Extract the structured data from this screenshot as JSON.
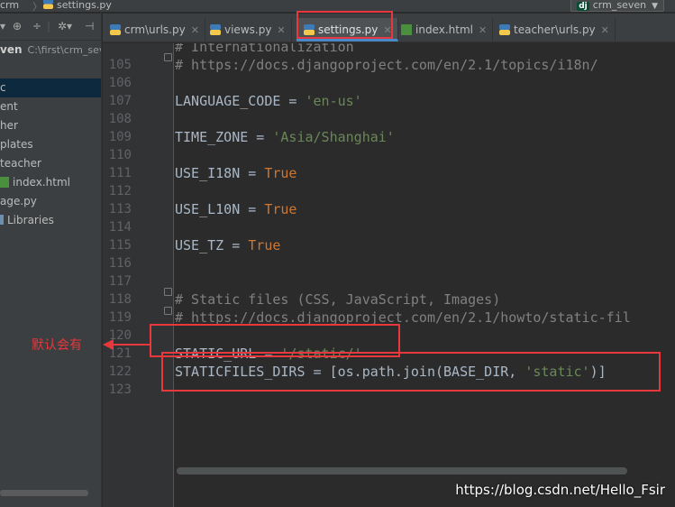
{
  "breadcrumb": {
    "project": "crm",
    "file": "settings.py"
  },
  "project_selector": {
    "badge": "dj",
    "label": "crm_seven"
  },
  "project_tree": {
    "root_name": "ven",
    "root_path": "C:\\first\\crm_seve",
    "items": [
      "c",
      "ent",
      "her",
      "plates",
      "teacher",
      "index.html",
      "age.py",
      "Libraries"
    ]
  },
  "tabs": [
    {
      "label": "crm\\urls.py"
    },
    {
      "label": "views.py"
    },
    {
      "label": "settings.py"
    },
    {
      "label": "index.html"
    },
    {
      "label": "teacher\\urls.py"
    }
  ],
  "editor": {
    "lines": [
      {
        "num": "",
        "tokens": [
          {
            "t": "# Internationalization",
            "c": "cmt"
          }
        ]
      },
      {
        "num": "105",
        "tokens": [
          {
            "t": "# https://docs.djangoproject.com/en/2.1/topics/i18n/",
            "c": "cmt"
          }
        ]
      },
      {
        "num": "106",
        "tokens": []
      },
      {
        "num": "107",
        "tokens": [
          {
            "t": "LANGUAGE_CODE",
            "c": "txt"
          },
          {
            "t": " = ",
            "c": "txt"
          },
          {
            "t": "'en-us'",
            "c": "str"
          }
        ]
      },
      {
        "num": "108",
        "tokens": []
      },
      {
        "num": "109",
        "tokens": [
          {
            "t": "TIME_ZONE",
            "c": "txt"
          },
          {
            "t": " = ",
            "c": "txt"
          },
          {
            "t": "'Asia/Shanghai'",
            "c": "str"
          }
        ]
      },
      {
        "num": "110",
        "tokens": []
      },
      {
        "num": "111",
        "tokens": [
          {
            "t": "USE_I18N",
            "c": "txt"
          },
          {
            "t": " = ",
            "c": "txt"
          },
          {
            "t": "True",
            "c": "kw"
          }
        ]
      },
      {
        "num": "112",
        "tokens": []
      },
      {
        "num": "113",
        "tokens": [
          {
            "t": "USE_L10N",
            "c": "txt"
          },
          {
            "t": " = ",
            "c": "txt"
          },
          {
            "t": "True",
            "c": "kw"
          }
        ]
      },
      {
        "num": "114",
        "tokens": []
      },
      {
        "num": "115",
        "tokens": [
          {
            "t": "USE_TZ",
            "c": "txt"
          },
          {
            "t": " = ",
            "c": "txt"
          },
          {
            "t": "True",
            "c": "kw"
          }
        ]
      },
      {
        "num": "116",
        "tokens": []
      },
      {
        "num": "117",
        "tokens": []
      },
      {
        "num": "118",
        "tokens": [
          {
            "t": "# Static files (CSS, JavaScript, Images)",
            "c": "cmt"
          }
        ]
      },
      {
        "num": "119",
        "tokens": [
          {
            "t": "# https://docs.djangoproject.com/en/2.1/howto/static-fil",
            "c": "cmt"
          }
        ]
      },
      {
        "num": "120",
        "tokens": []
      },
      {
        "num": "121",
        "tokens": [
          {
            "t": "STATIC_URL",
            "c": "txt"
          },
          {
            "t": " = ",
            "c": "txt"
          },
          {
            "t": "'/static/'",
            "c": "str"
          }
        ]
      },
      {
        "num": "122",
        "tokens": [
          {
            "t": "STATICFILES_DIRS",
            "c": "txt"
          },
          {
            "t": " = [os.path.join(BASE_DIR, ",
            "c": "txt"
          },
          {
            "t": "'static'",
            "c": "str"
          },
          {
            "t": ")]",
            "c": "txt"
          }
        ]
      },
      {
        "num": "123",
        "tokens": []
      }
    ]
  },
  "annotation": {
    "label": "默认会有"
  },
  "watermark": "https://blog.csdn.net/Hello_Fsir",
  "colors": {
    "highlight": "#e8373d",
    "keyword": "#cc7832",
    "string": "#6a8759",
    "comment": "#808080",
    "text": "#a9b7c6"
  }
}
